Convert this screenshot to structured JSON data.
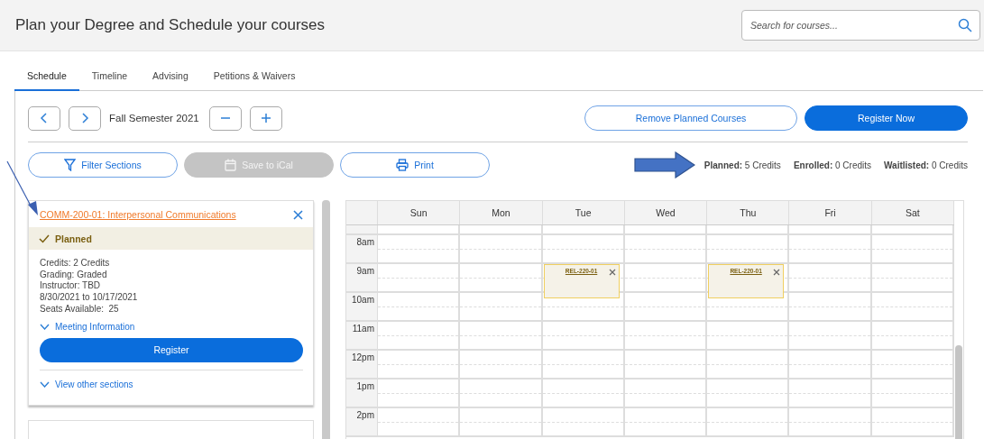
{
  "header": {
    "title": "Plan your Degree and Schedule your courses",
    "search": {
      "placeholder": "Search for courses..."
    }
  },
  "tabs": [
    {
      "label": "Schedule",
      "selected": true
    },
    {
      "label": "Timeline",
      "selected": false
    },
    {
      "label": "Advising",
      "selected": false
    },
    {
      "label": "Petitions & Waivers",
      "selected": false
    }
  ],
  "term": "Fall Semester 2021",
  "actions": [
    {
      "label": "Remove Planned Courses",
      "kind": "outline"
    },
    {
      "label": "Register Now",
      "kind": "primary"
    }
  ],
  "tools": [
    {
      "label": "Filter Sections",
      "kind": "filter",
      "disabled": false
    },
    {
      "label": "Save to iCal",
      "kind": "calendar",
      "disabled": true
    },
    {
      "label": "Print",
      "kind": "print",
      "disabled": false
    }
  ],
  "credits": [
    "**Planned:** 5 Credits",
    "**Enrolled:** 0 Credits",
    "**Waitlisted:** 0 Credits"
  ],
  "course": {
    "title": "COMM-200-01: Interpersonal Communications",
    "status": "Planned",
    "details": [
      "Credits: 2 Credits",
      "Grading: Graded",
      "Instructor: TBD",
      "8/30/2021 to 10/17/2021",
      "Seats Available:  25"
    ],
    "meeting_link": "Meeting Information",
    "register": "Register",
    "other_sections": "View other sections"
  },
  "calendar": {
    "days": [
      "Sun",
      "Mon",
      "Tue",
      "Wed",
      "Thu",
      "Fri",
      "Sat"
    ],
    "rows": [
      {
        "time": "8am"
      },
      {
        "time": "9am",
        "cells": [
          null,
          null,
          {
            "label": "REL-220-01"
          },
          null,
          {
            "label": "REL-220-01"
          },
          null,
          null
        ]
      },
      {
        "time": "10am"
      },
      {
        "time": "11am"
      },
      {
        "time": "12pm"
      },
      {
        "time": "1pm"
      },
      {
        "time": "2pm"
      }
    ]
  }
}
